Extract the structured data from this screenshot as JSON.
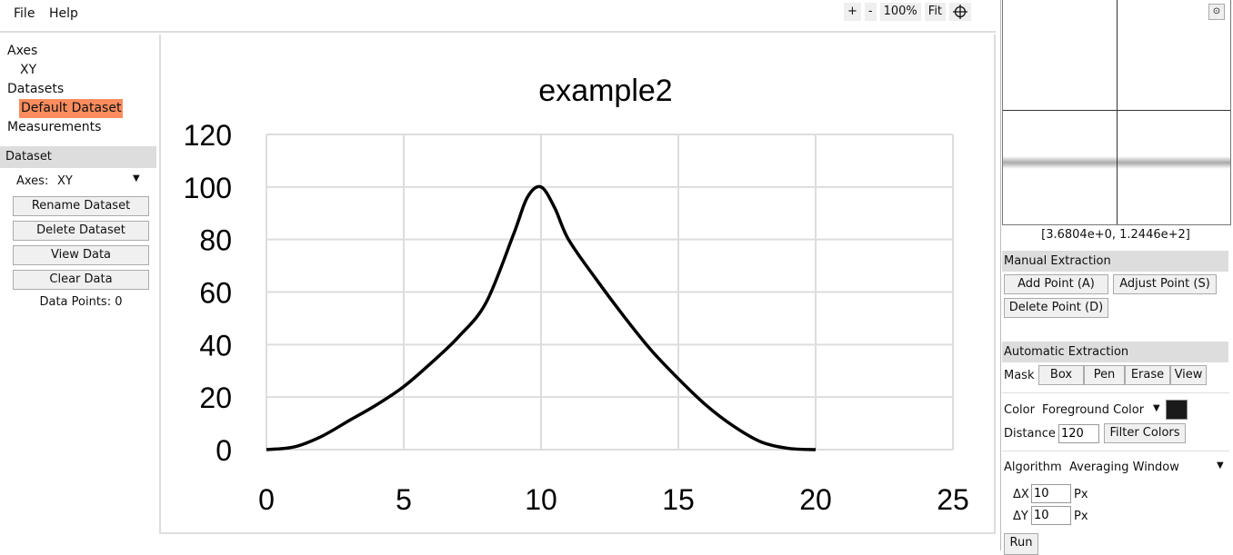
{
  "menu": {
    "file": "File",
    "help": "Help"
  },
  "toolbar": {
    "zoom_in": "+",
    "zoom_out": "-",
    "zoom_level": "100%",
    "fit": "Fit"
  },
  "tree": {
    "axes": "Axes",
    "axes_item": "XY",
    "datasets": "Datasets",
    "dataset_item": "Default Dataset",
    "measurements": "Measurements"
  },
  "dataset_panel": {
    "title": "Dataset",
    "axes_label": "Axes:",
    "axes_value": "XY",
    "rename": "Rename Dataset",
    "delete": "Delete Dataset",
    "view": "View Data",
    "clear": "Clear Data",
    "points_label": "Data Points:",
    "points_value": "0"
  },
  "zoom_view": {
    "cursor_coords": "[3.6804e+0, 1.2446e+2]"
  },
  "manual": {
    "title": "Manual Extraction",
    "add": "Add Point (A)",
    "adjust": "Adjust Point (S)",
    "delete": "Delete Point (D)"
  },
  "auto": {
    "title": "Automatic Extraction",
    "mask_label": "Mask",
    "mask_box": "Box",
    "mask_pen": "Pen",
    "mask_erase": "Erase",
    "mask_view": "View",
    "color_label": "Color",
    "color_mode": "Foreground Color",
    "color_swatch": "#1a1a1a",
    "distance_label": "Distance",
    "distance_value": "120",
    "filter": "Filter Colors",
    "algorithm_label": "Algorithm",
    "algorithm_value": "Averaging Window",
    "dx_label": "ΔX",
    "dx_value": "10",
    "dy_label": "ΔY",
    "dy_value": "10",
    "px": "Px",
    "run": "Run"
  },
  "chart_data": {
    "type": "line",
    "title": "example2",
    "xlim": [
      0,
      25
    ],
    "ylim": [
      0,
      120
    ],
    "xticks": [
      "0",
      "5",
      "10",
      "15",
      "20",
      "25"
    ],
    "yticks": [
      "0",
      "20",
      "40",
      "60",
      "80",
      "100",
      "120"
    ],
    "grid": true,
    "x": [
      0,
      1,
      2,
      3,
      4,
      5,
      6,
      7,
      8,
      9,
      9.5,
      10,
      10.5,
      11,
      12,
      13,
      14,
      15,
      16,
      17,
      18,
      19,
      20
    ],
    "y": [
      0,
      1,
      5,
      11,
      17,
      24,
      33,
      43,
      56,
      82,
      96,
      100,
      92,
      80,
      65,
      51,
      38,
      27,
      17,
      9,
      3,
      0.5,
      0
    ]
  }
}
